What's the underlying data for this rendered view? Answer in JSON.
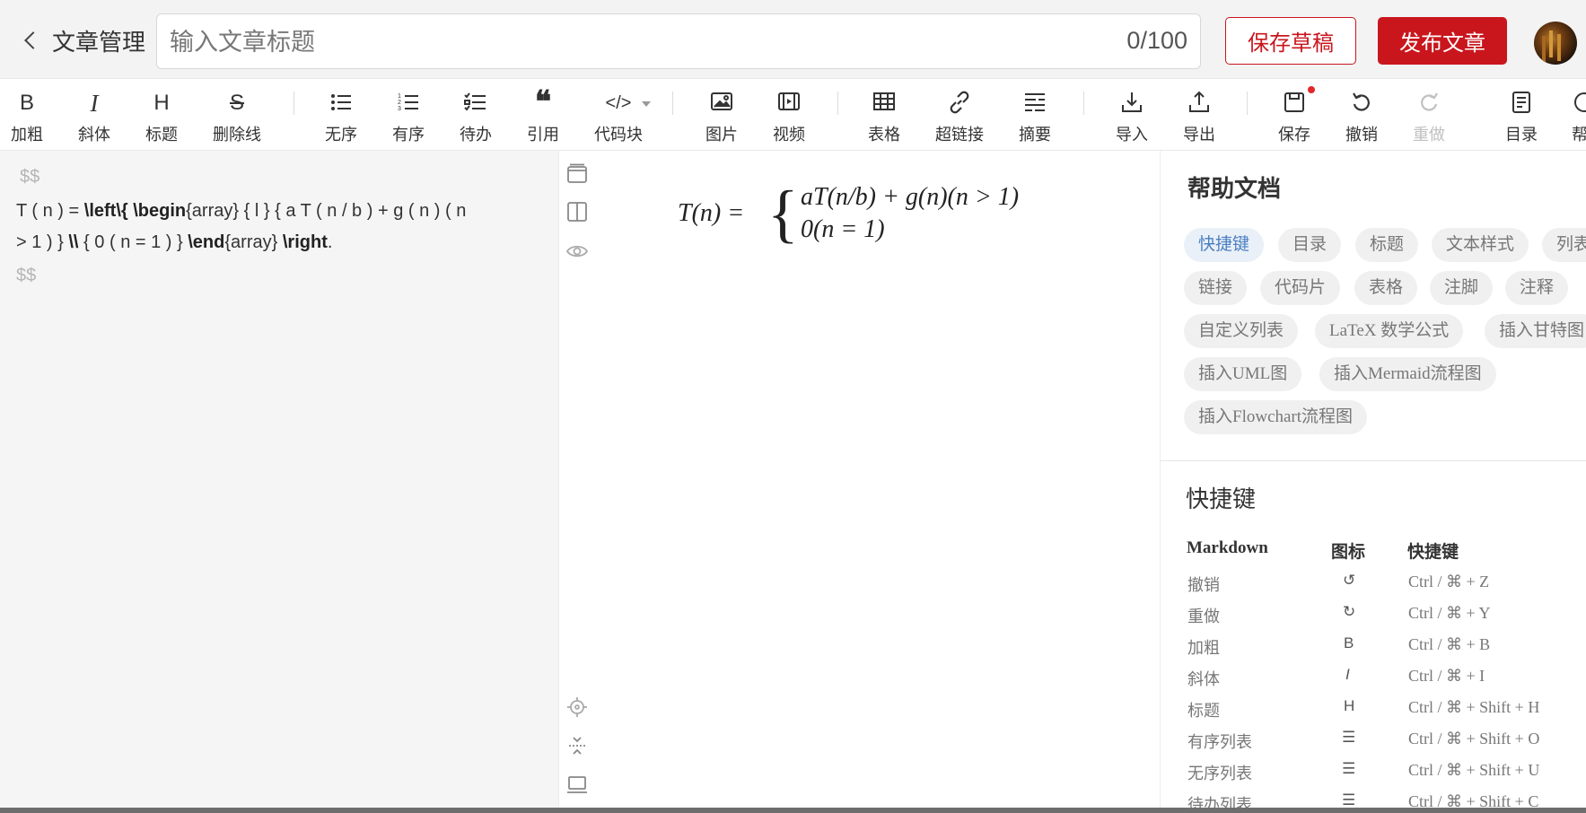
{
  "header": {
    "back_label": "文章管理",
    "title_placeholder": "输入文章标题",
    "title_value": "",
    "counter": "0/100",
    "save_draft_label": "保存草稿",
    "publish_label": "发布文章"
  },
  "toolbar": {
    "bold": "加粗",
    "italic": "斜体",
    "heading": "标题",
    "strike": "删除线",
    "unordered": "无序",
    "ordered": "有序",
    "todo": "待办",
    "quote": "引用",
    "codeblock": "代码块",
    "image": "图片",
    "video": "视频",
    "table": "表格",
    "link": "超链接",
    "summary": "摘要",
    "import": "导入",
    "export": "导出",
    "save": "保存",
    "undo": "撤销",
    "redo": "重做",
    "toc": "目录",
    "help": "帮"
  },
  "editor": {
    "line1": "$$",
    "line4": "$$"
  },
  "preview": {
    "lhs": "T(n) =",
    "case1": "aT(n/b) + g(n)(n > 1)",
    "case2": "0(n = 1)"
  },
  "help": {
    "title": "帮助文档",
    "tags": [
      "快捷键",
      "目录",
      "标题",
      "文本样式",
      "列表",
      "链接",
      "代码片",
      "表格",
      "注脚",
      "注释",
      "自定义列表",
      "LaTeX 数学公式",
      "插入甘特图",
      "插入UML图",
      "插入Mermaid流程图",
      "插入Flowchart流程图"
    ],
    "shortcuts_title": "快捷键",
    "table_headers": [
      "Markdown",
      "图标",
      "快捷键"
    ],
    "rows": [
      {
        "name": "撤销",
        "icon": "↺",
        "keys": "Ctrl / ⌘ + Z"
      },
      {
        "name": "重做",
        "icon": "↻",
        "keys": "Ctrl / ⌘ + Y"
      },
      {
        "name": "加粗",
        "icon": "B",
        "keys": "Ctrl / ⌘ + B"
      },
      {
        "name": "斜体",
        "icon": "I",
        "keys": "Ctrl / ⌘ + I"
      },
      {
        "name": "标题",
        "icon": "H",
        "keys": "Ctrl / ⌘ + Shift + H"
      },
      {
        "name": "有序列表",
        "icon": "☰",
        "keys": "Ctrl / ⌘ + Shift + O"
      },
      {
        "name": "无序列表",
        "icon": "☰",
        "keys": "Ctrl / ⌘ + Shift + U"
      },
      {
        "name": "待办列表",
        "icon": "☰",
        "keys": "Ctrl / ⌘ + Shift + C"
      }
    ]
  }
}
